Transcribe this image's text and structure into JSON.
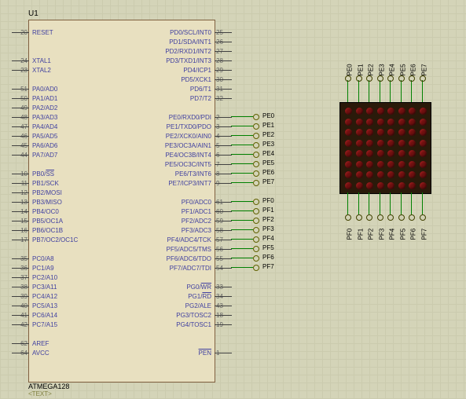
{
  "chip": {
    "ref": "U1",
    "name": "ATMEGA128",
    "placeholder": "<TEXT>",
    "left_groups": [
      {
        "start": 10,
        "pins": [
          {
            "num": "20",
            "label": "RESET"
          }
        ]
      },
      {
        "start": 46,
        "pins": [
          {
            "num": "24",
            "label": "XTAL1"
          },
          {
            "num": "23",
            "label": "XTAL2"
          }
        ]
      },
      {
        "start": 82,
        "pins": [
          {
            "num": "51",
            "label": "PA0/AD0"
          },
          {
            "num": "50",
            "label": "PA1/AD1"
          },
          {
            "num": "49",
            "label": "PA2/AD2"
          },
          {
            "num": "48",
            "label": "PA3/AD3"
          },
          {
            "num": "47",
            "label": "PA4/AD4"
          },
          {
            "num": "46",
            "label": "PA5/AD5"
          },
          {
            "num": "45",
            "label": "PA6/AD6"
          },
          {
            "num": "44",
            "label": "PA7/AD7"
          }
        ]
      },
      {
        "start": 190,
        "pins": [
          {
            "num": "10",
            "label": "PB0/SS",
            "overline_part": "SS"
          },
          {
            "num": "11",
            "label": "PB1/SCK"
          },
          {
            "num": "12",
            "label": "PB2/MOSI"
          },
          {
            "num": "13",
            "label": "PB3/MISO"
          },
          {
            "num": "14",
            "label": "PB4/OC0"
          },
          {
            "num": "15",
            "label": "PB5/OC1A"
          },
          {
            "num": "16",
            "label": "PB6/OC1B"
          },
          {
            "num": "17",
            "label": "PB7/OC2/OC1C"
          }
        ]
      },
      {
        "start": 298,
        "pins": [
          {
            "num": "35",
            "label": "PC0/A8"
          },
          {
            "num": "36",
            "label": "PC1/A9"
          },
          {
            "num": "37",
            "label": "PC2/A10"
          },
          {
            "num": "38",
            "label": "PC3/A11"
          },
          {
            "num": "39",
            "label": "PC4/A12"
          },
          {
            "num": "40",
            "label": "PC5/A13"
          },
          {
            "num": "41",
            "label": "PC6/A14"
          },
          {
            "num": "42",
            "label": "PC7/A15"
          }
        ]
      },
      {
        "start": 406,
        "pins": [
          {
            "num": "62",
            "label": "AREF"
          },
          {
            "num": "64",
            "label": "AVCC"
          }
        ]
      }
    ],
    "right_groups": [
      {
        "start": 10,
        "pins": [
          {
            "num": "25",
            "label": "PD0/SCL/INT0"
          },
          {
            "num": "26",
            "label": "PD1/SDA/INT1"
          },
          {
            "num": "27",
            "label": "PD2/RXD1/INT2"
          },
          {
            "num": "28",
            "label": "PD3/TXD1/INT3"
          },
          {
            "num": "29",
            "label": "PD4/ICP1"
          },
          {
            "num": "30",
            "label": "PD5/XCK1"
          },
          {
            "num": "31",
            "label": "PD6/T1"
          },
          {
            "num": "32",
            "label": "PD7/T2"
          }
        ]
      },
      {
        "start": 118,
        "pins": [
          {
            "num": "2",
            "label": "PE0/RXD0/PDI",
            "net": "PE0"
          },
          {
            "num": "3",
            "label": "PE1/TXD0/PDO",
            "net": "PE1"
          },
          {
            "num": "4",
            "label": "PE2/XCK0/AIN0",
            "net": "PE2"
          },
          {
            "num": "5",
            "label": "PE3/OC3A/AIN1",
            "net": "PE3"
          },
          {
            "num": "6",
            "label": "PE4/OC3B/INT4",
            "net": "PE4"
          },
          {
            "num": "7",
            "label": "PE5/OC3C/INT5",
            "net": "PE5"
          },
          {
            "num": "8",
            "label": "PE6/T3/INT6",
            "net": "PE6"
          },
          {
            "num": "9",
            "label": "PE7/ICP3/INT7",
            "net": "PE7"
          }
        ]
      },
      {
        "start": 226,
        "pins": [
          {
            "num": "61",
            "label": "PF0/ADC0",
            "net": "PF0"
          },
          {
            "num": "60",
            "label": "PF1/ADC1",
            "net": "PF1"
          },
          {
            "num": "59",
            "label": "PF2/ADC2",
            "net": "PF2"
          },
          {
            "num": "58",
            "label": "PF3/ADC3",
            "net": "PF3"
          },
          {
            "num": "57",
            "label": "PF4/ADC4/TCK",
            "net": "PF4"
          },
          {
            "num": "56",
            "label": "PF5/ADC5/TMS",
            "net": "PF5"
          },
          {
            "num": "55",
            "label": "PF6/ADC6/TDO",
            "net": "PF6"
          },
          {
            "num": "54",
            "label": "PF7/ADC7/TDI",
            "net": "PF7"
          }
        ]
      },
      {
        "start": 334,
        "pins": [
          {
            "num": "33",
            "label": "PG0/WR",
            "overline_part": "WR"
          },
          {
            "num": "34",
            "label": "PG1/RD",
            "overline_part": "RD"
          },
          {
            "num": "43",
            "label": "PG2/ALE"
          },
          {
            "num": "18",
            "label": "PG3/TOSC2"
          },
          {
            "num": "19",
            "label": "PG4/TOSC1"
          }
        ]
      },
      {
        "start": 418,
        "pins": [
          {
            "num": "1",
            "label": "PEN",
            "overline_part": "PEN"
          }
        ]
      }
    ]
  },
  "matrix": {
    "top_labels": [
      "PE0",
      "PE1",
      "PE2",
      "PE3",
      "PE4",
      "PE5",
      "PE6",
      "PE7"
    ],
    "bottom_labels": [
      "PF0",
      "PF1",
      "PF2",
      "PF3",
      "PF4",
      "PF5",
      "PF6",
      "PF7"
    ]
  }
}
